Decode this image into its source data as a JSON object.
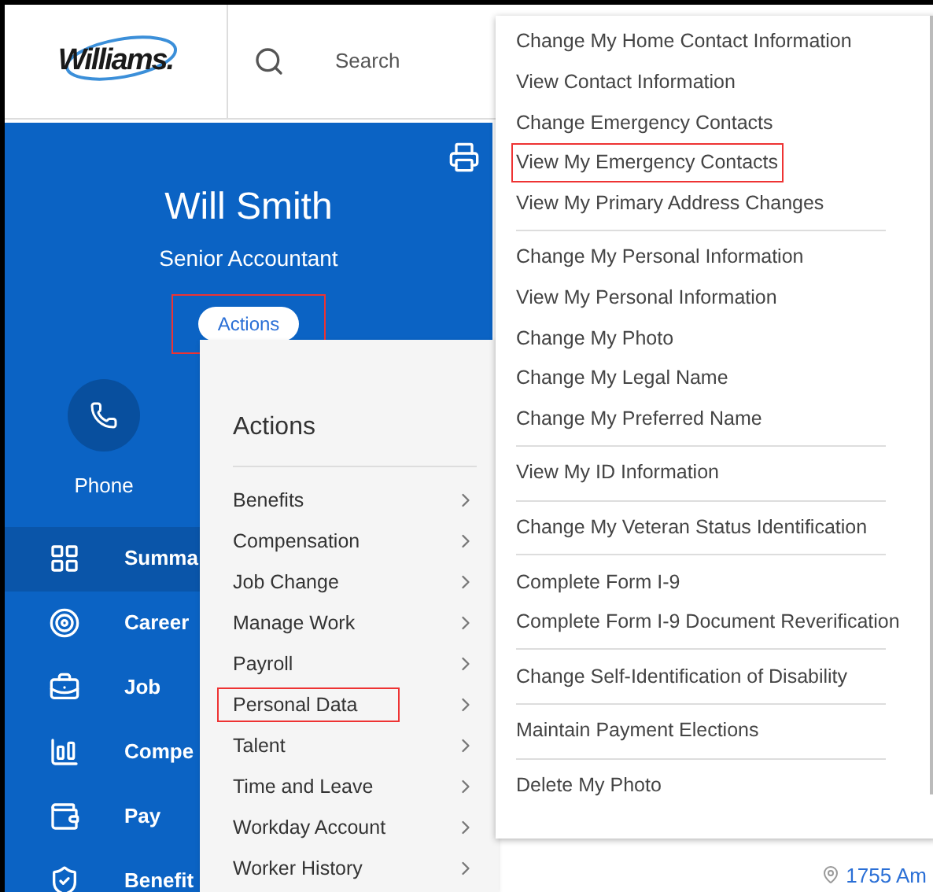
{
  "header": {
    "logo": "Williams.",
    "search": {
      "placeholder": "Search"
    }
  },
  "profile": {
    "name": "Will Smith",
    "job_title": "Senior Accountant",
    "actions_button": {
      "label": "Actions",
      "highlighted": true
    },
    "contact": {
      "label": "Phone"
    }
  },
  "nav": [
    {
      "label": "Summa",
      "selected": true
    },
    {
      "label": "Career",
      "selected": false
    },
    {
      "label": "Job",
      "selected": false
    },
    {
      "label": "Compe",
      "selected": false
    },
    {
      "label": "Pay",
      "selected": false
    },
    {
      "label": "Benefit",
      "selected": false
    }
  ],
  "actions_menu": {
    "title": "Actions",
    "items": [
      {
        "label": "Benefits",
        "highlighted": false
      },
      {
        "label": "Compensation",
        "highlighted": false
      },
      {
        "label": "Job Change",
        "highlighted": false
      },
      {
        "label": "Manage Work",
        "highlighted": false
      },
      {
        "label": "Payroll",
        "highlighted": false
      },
      {
        "label": "Personal Data",
        "highlighted": true
      },
      {
        "label": "Talent",
        "highlighted": false
      },
      {
        "label": "Time and Leave",
        "highlighted": false
      },
      {
        "label": "Workday Account",
        "highlighted": false
      },
      {
        "label": "Worker History",
        "highlighted": false
      }
    ]
  },
  "submenu": {
    "groups": [
      [
        {
          "label": "Change My Home Contact Information",
          "highlighted": false
        },
        {
          "label": "View Contact Information",
          "highlighted": false
        },
        {
          "label": "Change Emergency Contacts",
          "highlighted": false
        },
        {
          "label": "View My Emergency Contacts",
          "highlighted": true
        },
        {
          "label": "View My Primary Address Changes",
          "highlighted": false
        }
      ],
      [
        {
          "label": "Change My Personal Information",
          "highlighted": false
        },
        {
          "label": "View My Personal Information",
          "highlighted": false
        },
        {
          "label": "Change My Photo",
          "highlighted": false
        },
        {
          "label": "Change My Legal Name",
          "highlighted": false
        },
        {
          "label": "Change My Preferred Name",
          "highlighted": false
        }
      ],
      [
        {
          "label": "View My ID Information",
          "highlighted": false
        }
      ],
      [
        {
          "label": "Change My Veteran Status Identification",
          "highlighted": false
        }
      ],
      [
        {
          "label": "Complete Form I-9",
          "highlighted": false
        },
        {
          "label": "Complete Form I-9 Document Reverification",
          "highlighted": false
        }
      ],
      [
        {
          "label": "Change Self-Identification of Disability",
          "highlighted": false
        }
      ],
      [
        {
          "label": "Maintain Payment Elections",
          "highlighted": false
        }
      ],
      [
        {
          "label": "Delete My Photo",
          "highlighted": false
        }
      ]
    ]
  },
  "address_link": "1755 Am"
}
